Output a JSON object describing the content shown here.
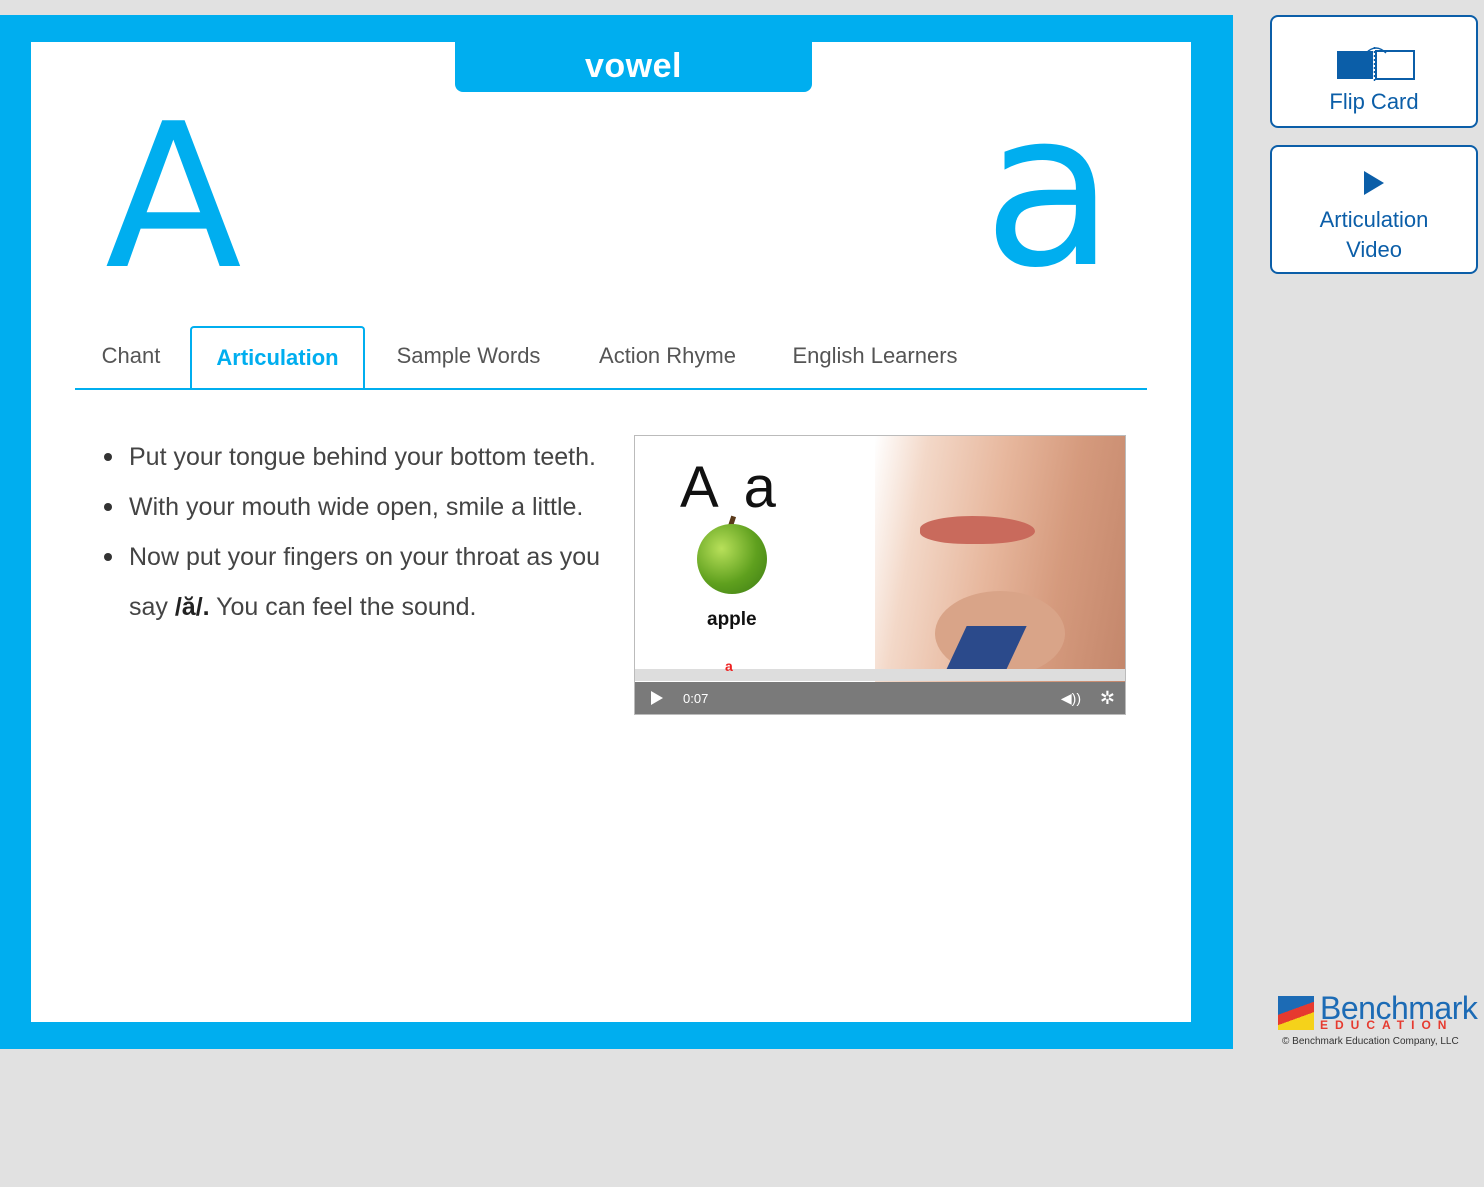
{
  "card": {
    "category": "vowel",
    "uppercase": "A",
    "lowercase": "a"
  },
  "tabs": [
    {
      "label": "Chant",
      "active": false
    },
    {
      "label": "Articulation",
      "active": true
    },
    {
      "label": "Sample Words",
      "active": false
    },
    {
      "label": "Action Rhyme",
      "active": false
    },
    {
      "label": "English Learners",
      "active": false
    }
  ],
  "instructions": {
    "item1": "Put your tongue behind your bottom teeth.",
    "item2": "With your mouth wide open, smile a little.",
    "item3_before": "Now put your fingers on your throat as you say ",
    "item3_sound": "/ă/.",
    "item3_after": " You can feel the sound."
  },
  "video": {
    "letters": "A a",
    "picture_word": "apple",
    "marker": "a",
    "time": "0:07"
  },
  "sidebar": {
    "flip_label": "Flip Card",
    "video_label_line1": "Articulation",
    "video_label_line2": "Video"
  },
  "logo": {
    "name": "Benchmark",
    "sub": "EDUCATION",
    "copyright": "© Benchmark Education Company, LLC"
  },
  "colors": {
    "accent": "#00aeef",
    "button_blue": "#0b5ea8"
  }
}
